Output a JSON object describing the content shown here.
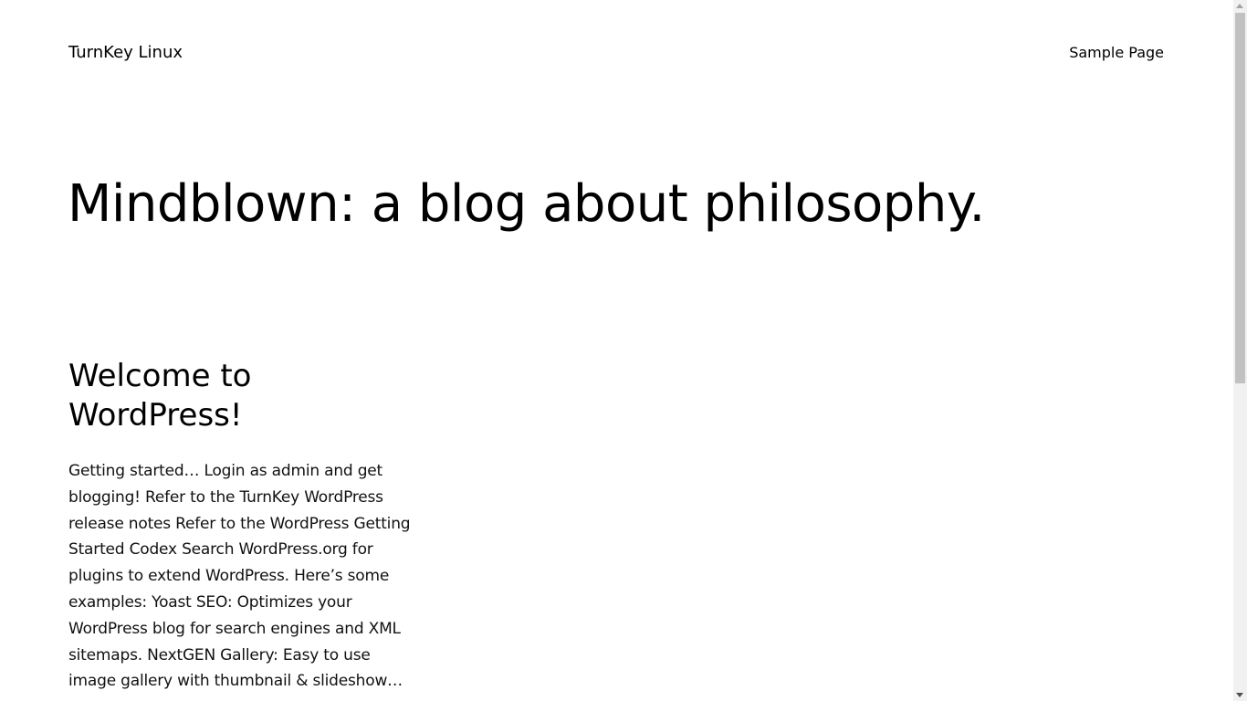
{
  "header": {
    "site_title": "TurnKey Linux",
    "nav": [
      {
        "label": "Sample Page"
      }
    ]
  },
  "main": {
    "heading": "Mindblown: a blog about philosophy.",
    "posts": [
      {
        "title": "Welcome to WordPress!",
        "excerpt": "Getting started… Login as admin and get blogging! Refer to the TurnKey WordPress release notes Refer to the WordPress Getting Started Codex Search WordPress.org for plugins to extend WordPress. Here’s some examples: Yoast SEO: Optimizes your WordPress blog for search engines and XML sitemaps. NextGEN Gallery: Easy to use image gallery with thumbnail & slideshow…"
      }
    ]
  },
  "scrollbar": {
    "up_icon": "chevron-up-icon",
    "down_icon": "chevron-down-icon"
  }
}
